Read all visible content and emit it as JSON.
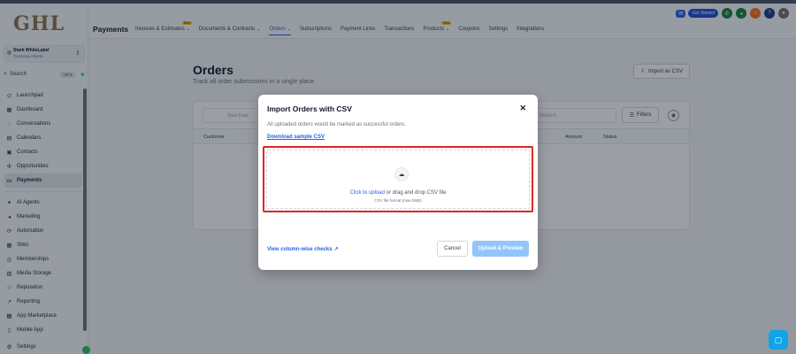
{
  "brand": {
    "logo_text": "GHL"
  },
  "account": {
    "name": "Stark WhiteLabel",
    "location": "Carmona Alberta"
  },
  "sidebar": {
    "search_label": "Search",
    "search_shortcut": "ctrl K",
    "items": [
      {
        "label": "Launchpad",
        "icon": "⊙",
        "icon_name": "rocket-icon"
      },
      {
        "label": "Dashboard",
        "icon": "▦",
        "icon_name": "dashboard-icon"
      },
      {
        "label": "Conversations",
        "icon": "◌",
        "icon_name": "chat-icon"
      },
      {
        "label": "Calendars",
        "icon": "▤",
        "icon_name": "calendar-icon"
      },
      {
        "label": "Contacts",
        "icon": "▣",
        "icon_name": "contacts-icon"
      },
      {
        "label": "Opportunities",
        "icon": "✣",
        "icon_name": "opportunities-icon"
      },
      {
        "label": "Payments",
        "icon": "▭",
        "icon_name": "payments-icon",
        "active": true
      }
    ],
    "items2": [
      {
        "label": "AI Agents",
        "icon": "✦",
        "icon_name": "ai-agents-icon"
      },
      {
        "label": "Marketing",
        "icon": "◂",
        "icon_name": "marketing-icon"
      },
      {
        "label": "Automation",
        "icon": "⟳",
        "icon_name": "automation-icon"
      },
      {
        "label": "Sites",
        "icon": "▦",
        "icon_name": "sites-icon"
      },
      {
        "label": "Memberships",
        "icon": "◎",
        "icon_name": "memberships-icon"
      },
      {
        "label": "Media Storage",
        "icon": "▧",
        "icon_name": "media-icon"
      },
      {
        "label": "Reputation",
        "icon": "☆",
        "icon_name": "reputation-icon"
      },
      {
        "label": "Reporting",
        "icon": "↗",
        "icon_name": "reporting-icon"
      },
      {
        "label": "App Marketplace",
        "icon": "▩",
        "icon_name": "marketplace-icon"
      },
      {
        "label": "Mobile App",
        "icon": "▯",
        "icon_name": "mobile-icon"
      }
    ],
    "settings_label": "Settings"
  },
  "header": {
    "title": "Payments",
    "tabs": [
      {
        "label": "Invoices & Estimates",
        "new": true,
        "caret": true
      },
      {
        "label": "Documents & Contracts",
        "caret": true
      },
      {
        "label": "Orders",
        "caret": true,
        "active": true
      },
      {
        "label": "Subscriptions"
      },
      {
        "label": "Payment Links"
      },
      {
        "label": "Transactions"
      },
      {
        "label": "Products",
        "new": true,
        "caret": true
      },
      {
        "label": "Coupons"
      },
      {
        "label": "Settings"
      },
      {
        "label": "Integrations"
      }
    ],
    "new_badge": "New",
    "get_started": "Get Started"
  },
  "page": {
    "title": "Orders",
    "subtitle": "Track all order submissions in a single place",
    "import_button": "Import as CSV",
    "date_placeholder": "Start Date",
    "search_placeholder": "Search",
    "filters_label": "Filters",
    "columns": [
      "Customer",
      "Amount",
      "Status"
    ]
  },
  "modal": {
    "title": "Import Orders with CSV",
    "info": "All uploaded orders would be marked as successful orders.",
    "sample_link": "Download sample CSV",
    "upload_link": "Click to upload",
    "upload_text": " or drag and drop CSV file",
    "hint": "CSV file format (max 5MB)",
    "columns_link": "View column-wise checks",
    "cancel": "Cancel",
    "submit": "Upload & Preview"
  }
}
